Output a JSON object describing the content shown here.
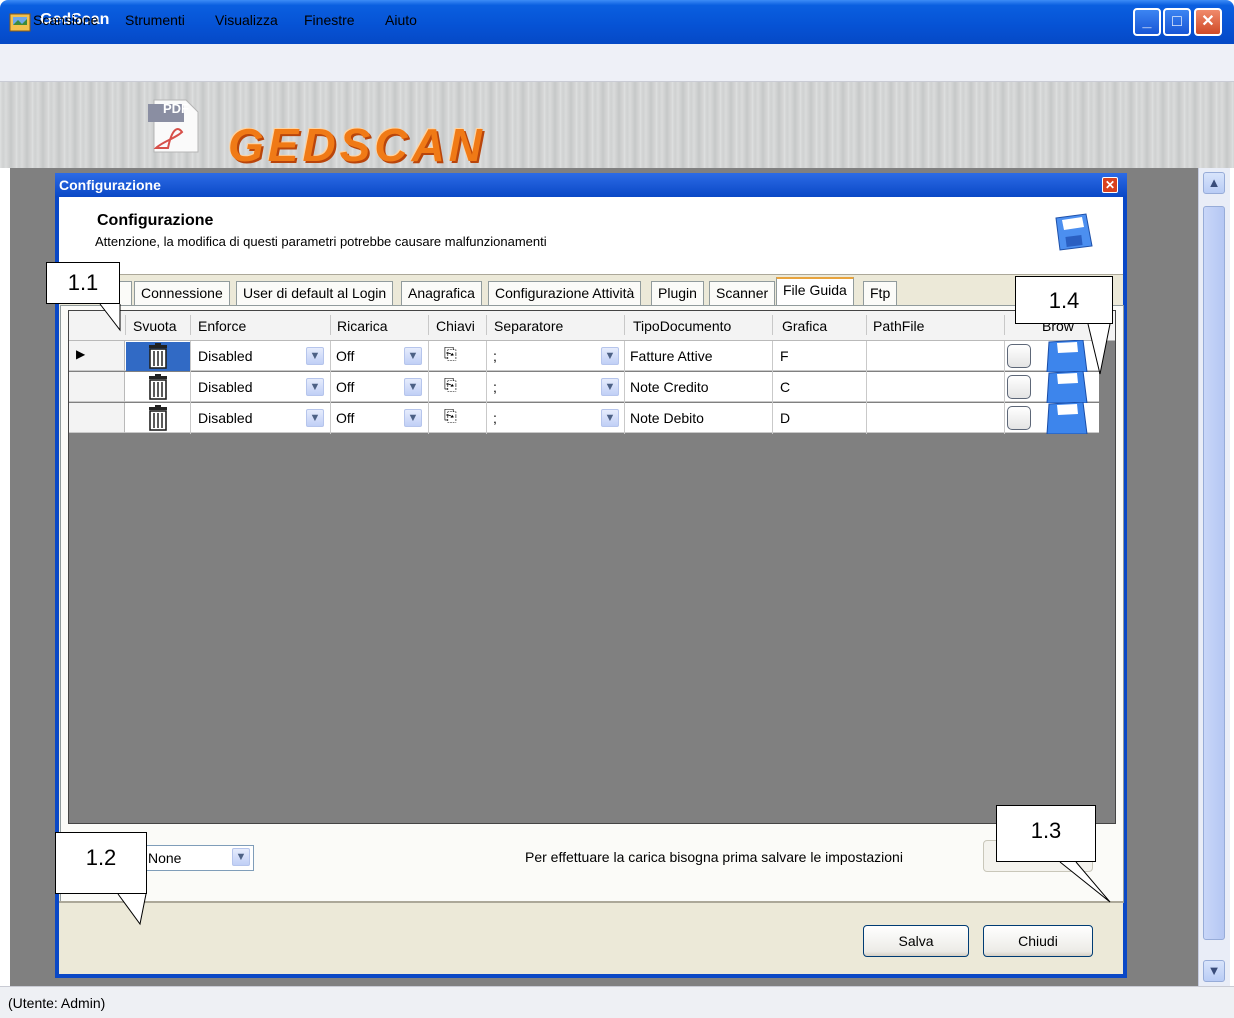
{
  "window": {
    "title": "GedScan",
    "minimize_glyph": "_",
    "maximize_glyph": "□",
    "close_glyph": "✕"
  },
  "menu": [
    "Scansione",
    "Strumenti",
    "Visualizza",
    "Finestre",
    "Aiuto"
  ],
  "banner": {
    "logo_text": "GEDSCAN",
    "pdf_label": "PDF"
  },
  "dialog": {
    "title": "Configurazione",
    "header_title": "Configurazione",
    "warning": "Attenzione, la modifica di questi parametri potrebbe causare malfunzionamenti",
    "tabs": [
      "i",
      "Connessione",
      "User di default al Login",
      "Anagrafica",
      "Configurazione Attività",
      "Plugin",
      "Scanner",
      "File Guida",
      "Ftp"
    ],
    "active_tab": "File Guida",
    "grid": {
      "columns": [
        "Svuota",
        "Enforce",
        "Ricarica",
        "Chiavi",
        "Separatore",
        "TipoDocumento",
        "Grafica",
        "PathFile",
        "Brow"
      ],
      "rows": [
        {
          "enforce": "Disabled",
          "ricarica": "Off",
          "separatore": ";",
          "tipo": "Fatture Attive",
          "grafica": "F",
          "path": ""
        },
        {
          "enforce": "Disabled",
          "ricarica": "Off",
          "separatore": ";",
          "tipo": "Note Credito",
          "grafica": "C",
          "path": ""
        },
        {
          "enforce": "Disabled",
          "ricarica": "Off",
          "separatore": ";",
          "tipo": "Note Debito",
          "grafica": "D",
          "path": ""
        }
      ]
    },
    "combo_value": "None",
    "load_hint": "Per effettuare la carica bisogna prima salvare le impostazioni",
    "carica_label": "Carica",
    "save_label": "Salva",
    "close_label": "Chiudi"
  },
  "status": "(Utente: Admin)",
  "callouts": [
    "1.1",
    "1.2",
    "1.3",
    "1.4"
  ],
  "icons": [
    "app-icon",
    "pdf-icon",
    "save-disk-icon",
    "trash-icon",
    "copy-keys-icon",
    "floppy-browse-icon",
    "chevron-down-icon",
    "row-pointer-icon"
  ]
}
